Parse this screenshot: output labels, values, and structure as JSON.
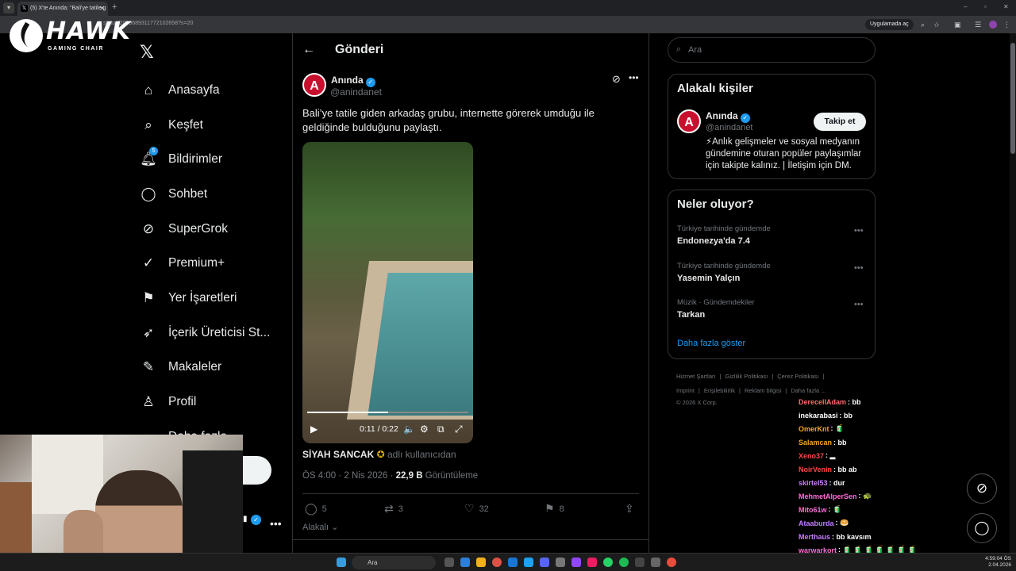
{
  "browser": {
    "tab_title": "(5) X'te Anında: \"Bali'ye tatile g",
    "url": "status/2039689311772102658?s=20",
    "app_pill": "Uygulamada aç"
  },
  "overlay": {
    "logo_word": "HAWK",
    "logo_sub": "GAMING CHAIR"
  },
  "nav": {
    "items": [
      {
        "label": "Anasayfa",
        "icon": "home-icon"
      },
      {
        "label": "Keşfet",
        "icon": "search-icon"
      },
      {
        "label": "Bildirimler",
        "icon": "bell-icon",
        "badge": "5"
      },
      {
        "label": "Sohbet",
        "icon": "chat-icon"
      },
      {
        "label": "SuperGrok",
        "icon": "grok-icon"
      },
      {
        "label": "Premium+",
        "icon": "premium-icon"
      },
      {
        "label": "Yer İşaretleri",
        "icon": "bookmark-icon"
      },
      {
        "label": "İçerik Üreticisi St...",
        "icon": "rocket-icon"
      },
      {
        "label": "Makaleler",
        "icon": "article-icon"
      },
      {
        "label": "Profil",
        "icon": "profile-icon"
      },
      {
        "label": "Daha fazla",
        "icon": "more-circle-icon"
      }
    ]
  },
  "header": {
    "title": "Gönderi"
  },
  "post": {
    "display_name": "Anında",
    "handle": "@anindanet",
    "avatar_letter": "A",
    "text": "Bali’ye tatile giden arkadaş grubu, internette görerek umduğu ile geldiğinde bulduğunu paylaştı.",
    "video": {
      "time": "0:11 / 0:22",
      "progress": 0.5
    },
    "attribution_name": "SİYAH SANCAK",
    "attribution_suffix": "adlı kullanıcıdan",
    "timestamp": "ÖS 4:00 · 2 Nis 2026 ·",
    "views": "22,9 B",
    "views_label": "Görüntüleme",
    "replies": "5",
    "reposts": "3",
    "likes": "32",
    "bookmarks": "8",
    "related_label": "Alakalı"
  },
  "search": {
    "placeholder": "Ara"
  },
  "related_people": {
    "title": "Alakalı kişiler",
    "name": "Anında",
    "handle": "@anindanet",
    "follow_label": "Takip et",
    "bio": "⚡Anlık gelişmeler ve sosyal medyanın gündemine oturan popüler paylaşımlar için takipte kalınız. | İletişim için DM."
  },
  "trends": {
    "title": "Neler oluyor?",
    "items": [
      {
        "context": "Türkiye tarihinde gündemde",
        "name": "Endonezya'da 7.4"
      },
      {
        "context": "Türkiye tarihinde gündemde",
        "name": "Yasemin Yalçın"
      },
      {
        "context": "Müzik · Gündemdekiler",
        "name": "Tarkan"
      }
    ],
    "show_more": "Daha fazla göster"
  },
  "footer": {
    "links1": [
      "Hizmet Şartları",
      "|",
      "Gizlilik Politikası",
      "|",
      "Çerez Politikası",
      "|"
    ],
    "links2": [
      "Imprint",
      "|",
      "Erişilebilirlik",
      "|",
      "Reklam bilgisi",
      "|",
      "Daha fazla ..."
    ],
    "copyright": "© 2026 X Corp."
  },
  "chat": [
    {
      "user": "DerecellAdam",
      "msg": ": bb",
      "color": "#ff6b6b"
    },
    {
      "user": "inekarabasi",
      "msg": ": bb",
      "color": "#ffffff"
    },
    {
      "user": "OmerKnt",
      "msg": ": 🧃",
      "color": "#f5a623"
    },
    {
      "user": "Salamcan",
      "msg": ": bb",
      "color": "#f5a623"
    },
    {
      "user": "Xeno37",
      "msg": ": ▂",
      "color": "#ff4444"
    },
    {
      "user": "NoirVenin",
      "msg": ": bb ab",
      "color": "#ff4444"
    },
    {
      "user": "skirtel53",
      "msg": ": dur",
      "color": "#c77dff"
    },
    {
      "user": "MehmetAlperSen",
      "msg": ": 🐢",
      "color": "#ff6bd5"
    },
    {
      "user": "Mito61w",
      "msg": ": 🧃",
      "color": "#ff6bd5"
    },
    {
      "user": "Ataaburda",
      "msg": ": 🥯",
      "color": "#c77dff"
    },
    {
      "user": "Merthaus",
      "msg": ": bb kavsım",
      "color": "#c77dff"
    },
    {
      "user": "warwarkort",
      "msg": ": 🧃 🧃 🧃 🧃 🧃 🧃 🧃",
      "color": "#ff6bd5"
    }
  ],
  "taskbar": {
    "search_placeholder": "Ara",
    "time": "4:59:04 ÖS",
    "date": "2.04.2026"
  },
  "colors": {
    "accent": "#1d9bf0",
    "brand_red": "#c8102e",
    "bg": "#000000"
  }
}
